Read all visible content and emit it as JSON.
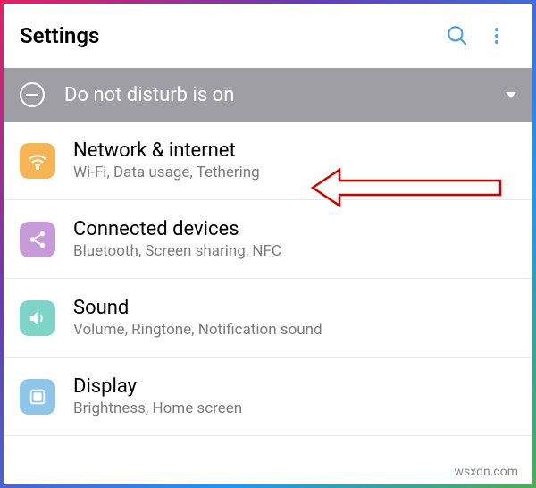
{
  "header": {
    "title": "Settings"
  },
  "dnd": {
    "text": "Do not disturb is on"
  },
  "items": [
    {
      "title": "Network & internet",
      "subtitle": "Wi-Fi, Data usage, Tethering",
      "iconColor": "#f5b455"
    },
    {
      "title": "Connected devices",
      "subtitle": "Bluetooth, Screen sharing, NFC",
      "iconColor": "#c79bd8"
    },
    {
      "title": "Sound",
      "subtitle": "Volume, Ringtone, Notification sound",
      "iconColor": "#7ed4c7"
    },
    {
      "title": "Display",
      "subtitle": "Brightness, Home screen",
      "iconColor": "#8fc5e8"
    }
  ],
  "watermark": "wsxdn.com"
}
